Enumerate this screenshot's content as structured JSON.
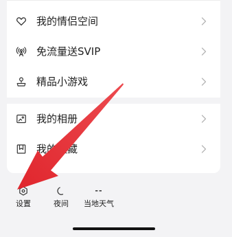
{
  "menu": {
    "group1": [
      {
        "label": "我的情侣空间",
        "icon": "heart-icon"
      },
      {
        "label": "免流量送SVIP",
        "icon": "signal-icon"
      },
      {
        "label": "精品小游戏",
        "icon": "game-icon"
      }
    ],
    "group2": [
      {
        "label": "我的相册",
        "icon": "photo-album-icon"
      },
      {
        "label": "我的收藏",
        "icon": "bookmark-icon"
      }
    ]
  },
  "bottom_bar": {
    "settings": {
      "label": "设置",
      "icon": "hexagon-settings-icon"
    },
    "night": {
      "label": "夜间",
      "icon": "moon-icon"
    },
    "weather": {
      "label": "当地天气",
      "value": "--"
    }
  },
  "colors": {
    "page_background": "#f3f3f5",
    "card_background": "#ffffff",
    "text": "#1f1f1f",
    "chevron": "#b5b5b5",
    "annotation_arrow": "#e8333a"
  }
}
